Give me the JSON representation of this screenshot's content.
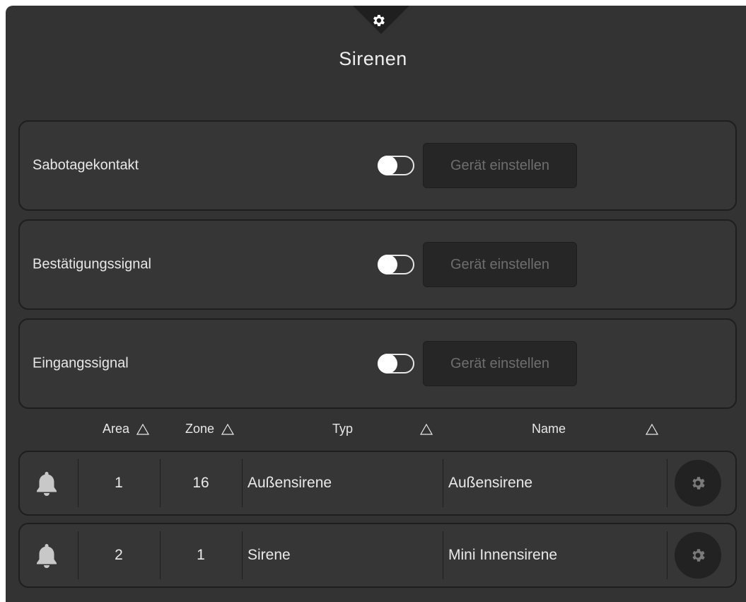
{
  "panel": {
    "title": "Sirenen"
  },
  "settings": [
    {
      "label": "Sabotagekontakt",
      "button": "Gerät einstellen",
      "enabled": false
    },
    {
      "label": "Bestätigungssignal",
      "button": "Gerät einstellen",
      "enabled": false
    },
    {
      "label": "Eingangssignal",
      "button": "Gerät einstellen",
      "enabled": false
    }
  ],
  "table": {
    "headers": {
      "area": "Area",
      "zone": "Zone",
      "typ": "Typ",
      "name": "Name"
    },
    "rows": [
      {
        "icon": "bell-icon",
        "area": "1",
        "zone": "16",
        "typ": "Außensirene",
        "name": "Außensirene"
      },
      {
        "icon": "bell-icon",
        "area": "2",
        "zone": "1",
        "typ": "Sirene",
        "name": "Mini Innensirene"
      }
    ]
  },
  "colors": {
    "panel": "#333333",
    "card": "#363636",
    "border": "#1e1e1e",
    "text": "#e8e8e8",
    "button_text": "#6e6e6e"
  }
}
